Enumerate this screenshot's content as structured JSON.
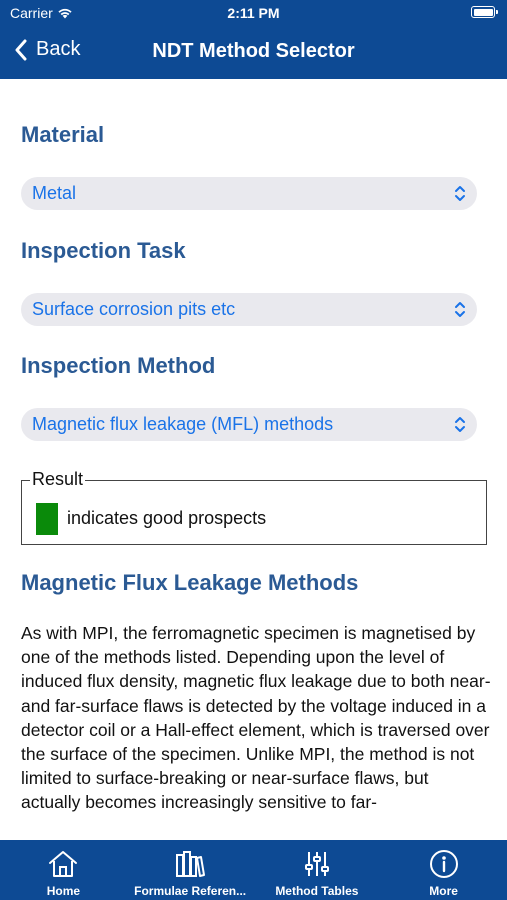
{
  "status_bar": {
    "carrier": "Carrier",
    "time": "2:11 PM"
  },
  "nav": {
    "back_label": "Back",
    "title": "NDT Method Selector"
  },
  "material": {
    "heading": "Material",
    "selected": "Metal"
  },
  "inspection_task": {
    "heading": "Inspection Task",
    "selected": "Surface corrosion pits etc"
  },
  "inspection_method": {
    "heading": "Inspection Method",
    "selected": "Magnetic flux leakage (MFL) methods"
  },
  "result": {
    "legend": "Result",
    "text": "indicates good prospects",
    "color": "#0a8a0a"
  },
  "method_info": {
    "heading": "Magnetic Flux Leakage Methods",
    "body": "As with MPI, the ferromagnetic specimen is magnetised by one of the methods listed. Depending upon the level of induced flux density, magnetic flux leakage due to both near- and far-surface flaws is detected by the voltage induced in a detector coil or a Hall-effect element, which is traversed over the surface of the specimen. Unlike MPI, the method is not limited to surface-breaking or near-surface flaws, but actually becomes increasingly sensitive to far-"
  },
  "tabs": [
    {
      "label": "Home",
      "icon": "home-icon"
    },
    {
      "label": "Formulae Referen...",
      "icon": "books-icon"
    },
    {
      "label": "Method Tables",
      "icon": "sliders-icon"
    },
    {
      "label": "More",
      "icon": "info-icon"
    }
  ],
  "colors": {
    "header": "#0d4a94",
    "heading": "#2b5a94",
    "link": "#1a73e8"
  }
}
